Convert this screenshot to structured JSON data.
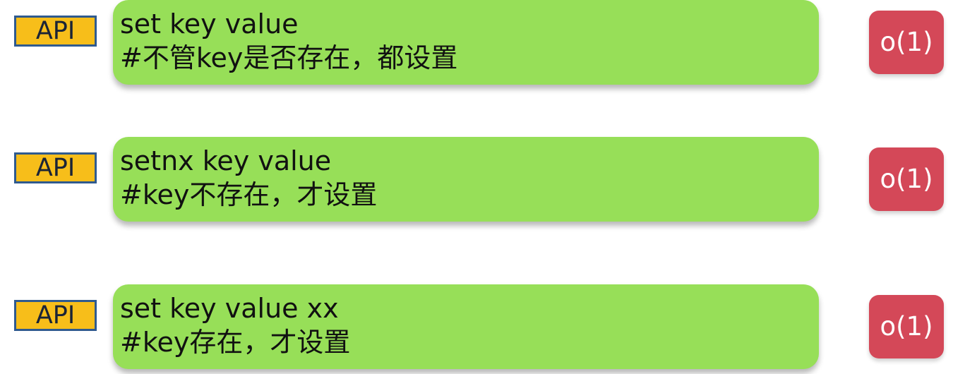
{
  "commands": [
    {
      "badge": "API",
      "command": "set key value",
      "comment": "#不管key是否存在，都设置",
      "complexity": "o(1)"
    },
    {
      "badge": "API",
      "command": "setnx key value",
      "comment": "#key不存在，才设置",
      "complexity": "o(1)"
    },
    {
      "badge": "API",
      "command": "set key value xx",
      "comment": "#key存在，才设置",
      "complexity": "o(1)"
    }
  ]
}
